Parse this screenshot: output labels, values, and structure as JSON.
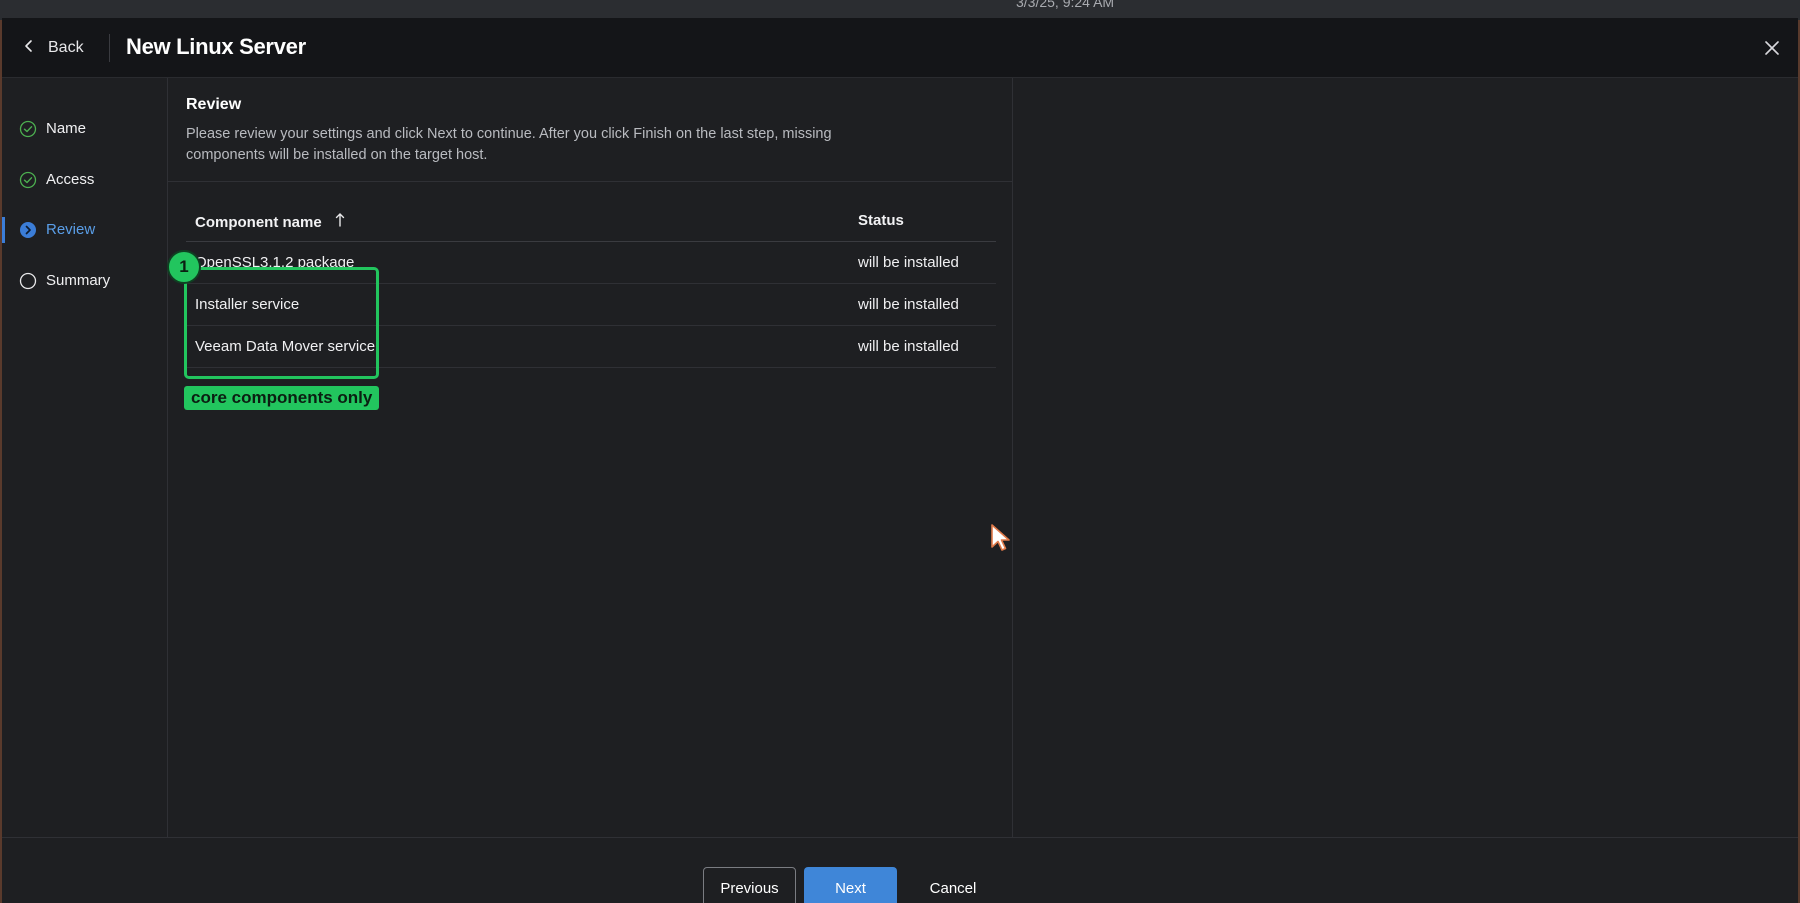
{
  "taskbar": {
    "clock": "3/3/25, 9:24 AM"
  },
  "header": {
    "back_label": "Back",
    "title": "New Linux Server"
  },
  "steps": [
    {
      "label": "Name",
      "state": "completed"
    },
    {
      "label": "Access",
      "state": "completed"
    },
    {
      "label": "Review",
      "state": "current"
    },
    {
      "label": "Summary",
      "state": "pending"
    }
  ],
  "review": {
    "title": "Review",
    "description": "Please review your settings and click Next to continue. After you click Finish on the last step, missing components will be installed on the target host.",
    "columns": {
      "name": "Component name",
      "status": "Status"
    },
    "rows": [
      {
        "name": "OpenSSL3.1.2 package",
        "status": "will be installed"
      },
      {
        "name": "Installer service",
        "status": "will be installed"
      },
      {
        "name": "Veeam Data Mover service",
        "status": "will be installed"
      }
    ]
  },
  "annotation": {
    "badge": "1",
    "label": "core components only",
    "color": "#22c55e"
  },
  "footer": {
    "previous": "Previous",
    "next": "Next",
    "cancel": "Cancel"
  },
  "colors": {
    "accent": "#3f86d8",
    "completed": "#4caf50",
    "background": "#1e1f22"
  }
}
